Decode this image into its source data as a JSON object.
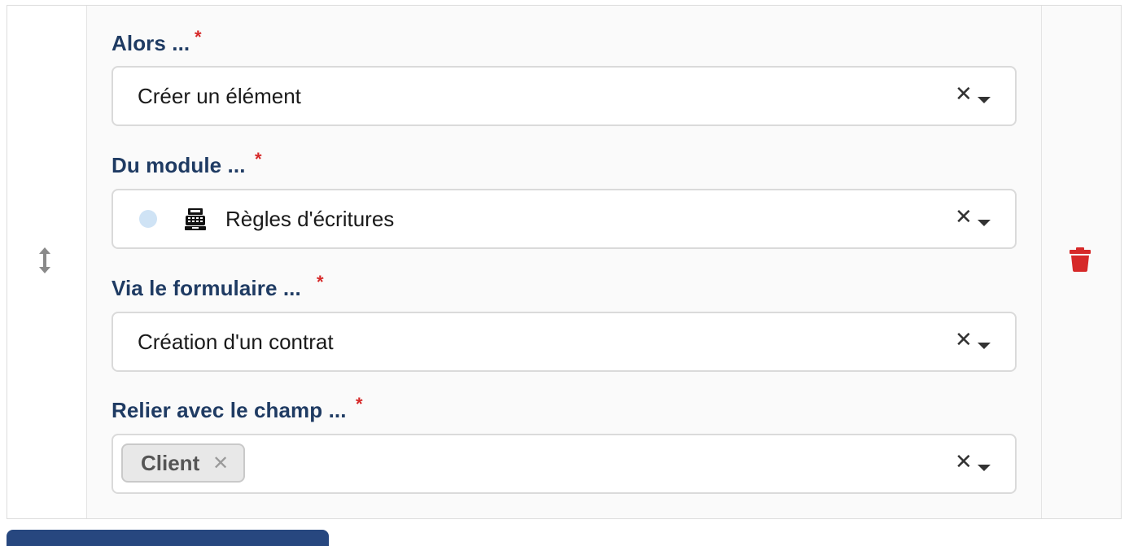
{
  "fields": {
    "action": {
      "label": "Alors ...",
      "required_mark": "*",
      "value": "Créer un élément",
      "clear_symbol": "✕"
    },
    "module": {
      "label": "Du module ...",
      "required_mark": "*",
      "value": "Règles d'écritures",
      "icon": "cash-register-icon",
      "clear_symbol": "✕"
    },
    "form": {
      "label": "Via le formulaire ...",
      "required_mark": "*",
      "value": "Création d'un contrat",
      "clear_symbol": "✕"
    },
    "link_field": {
      "label": "Relier avec le champ ...",
      "required_mark": "*",
      "tags": [
        {
          "label": "Client",
          "remove_symbol": "✕"
        }
      ],
      "clear_symbol": "✕"
    }
  },
  "colors": {
    "label": "#1f3b63",
    "required": "#d62828",
    "delete": "#d62828",
    "handle": "#8a8a8a",
    "primary_button": "#27477f"
  }
}
